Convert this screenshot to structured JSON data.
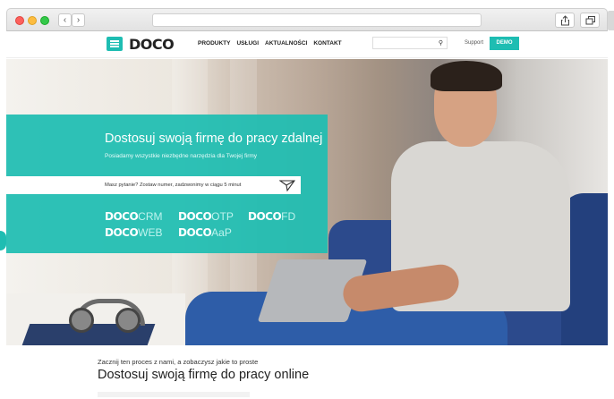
{
  "browser": {
    "back_label": "‹",
    "forward_label": "›",
    "icons": [
      "share-icon",
      "tabs-icon"
    ]
  },
  "header": {
    "logo": "DOCO",
    "menu": [
      "PRODUKTY",
      "USŁUGI",
      "AKTUALNOŚCI",
      "KONTAKT"
    ],
    "search_icon": "⚲",
    "support_label": "Support",
    "demo_label": "DEMO",
    "accent_color": "#1ebdb2"
  },
  "hero": {
    "title": "Dostosuj swoją firmę do pracy zdalnej",
    "subtitle": "Posiadamy wszystkie niezbędne narzędzia dla Twojej firmy",
    "phone_prompt": "Masz pytanie? Zostaw numer, zadzwonimy w ciągu 5 minut",
    "products": [
      {
        "brand": "DOCO",
        "name": "CRM"
      },
      {
        "brand": "DOCO",
        "name": "OTP"
      },
      {
        "brand": "DOCO",
        "name": "FD"
      },
      {
        "brand": "DOCO",
        "name": "WEB"
      },
      {
        "brand": "DOCO",
        "name": "AaP"
      }
    ]
  },
  "intro": {
    "small": "Zacznij ten proces z nami, a zobaczysz jakie to proste",
    "title": "Dostosuj swoją firmę do pracy online"
  }
}
